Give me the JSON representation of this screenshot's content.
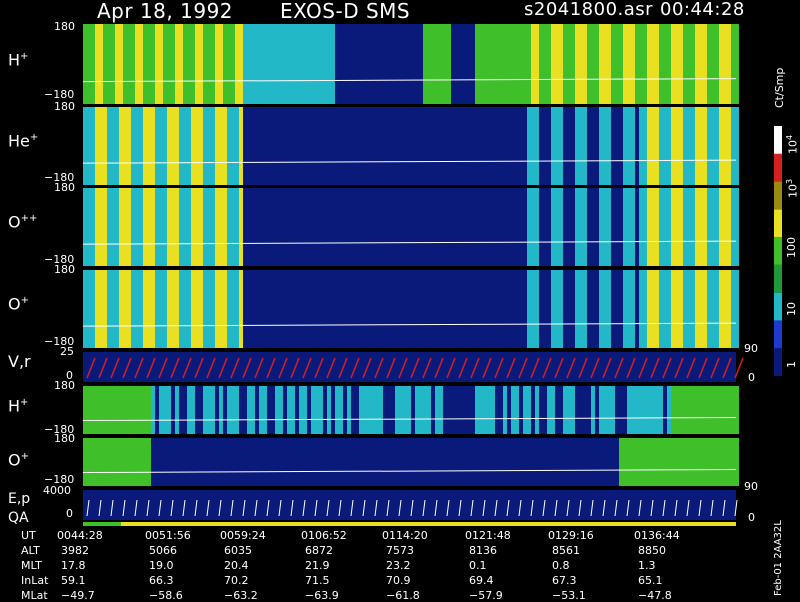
{
  "header": {
    "date": "Apr 18, 1992",
    "instrument": "EXOS-D SMS",
    "file": "s2041800.asr",
    "time": "00:44:28"
  },
  "panels": [
    {
      "label": "H",
      "sup": "+",
      "tick_top": "180",
      "tick_bottom": "−180"
    },
    {
      "label": "He",
      "sup": "+",
      "tick_top": "180",
      "tick_bottom": "−180"
    },
    {
      "label": "O",
      "sup": "++",
      "tick_top": "180",
      "tick_bottom": "−180"
    },
    {
      "label": "O",
      "sup": "+",
      "tick_top": "180",
      "tick_bottom": "−180"
    },
    {
      "label": "V,r",
      "sup": "",
      "tick_top": "25",
      "tick_bottom": "0",
      "tick_right_top": "90",
      "tick_right_bottom": "0"
    },
    {
      "label": "H",
      "sup": "+",
      "tick_top": "180",
      "tick_bottom": "−180"
    },
    {
      "label": "O",
      "sup": "+",
      "tick_top": "180",
      "tick_bottom": "−180",
      "tick_right_bottom": "90"
    },
    {
      "label": "E,p",
      "sup": "",
      "label2": "QA",
      "tick_top": "4000",
      "tick_bottom": "0",
      "tick_right_bottom": "0"
    }
  ],
  "colorbar": {
    "unit": "Ct/Smp",
    "ticks": [
      {
        "base": "10",
        "exp": "4"
      },
      {
        "base": "10",
        "exp": "3"
      },
      {
        "base": "100",
        "exp": ""
      },
      {
        "base": "10",
        "exp": ""
      },
      {
        "base": "1",
        "exp": ""
      }
    ]
  },
  "footer": {
    "side_label": "Feb-01 2AA32L",
    "rows": [
      {
        "name": "UT",
        "values": [
          "0044:28",
          "0051:56",
          "0059:24",
          "0106:52",
          "0114:20",
          "0121:48",
          "0129:16",
          "0136:44"
        ]
      },
      {
        "name": "ALT",
        "values": [
          "3982",
          "5066",
          "6035",
          "6872",
          "7573",
          "8136",
          "8561",
          "8850"
        ]
      },
      {
        "name": "MLT",
        "values": [
          "17.8",
          "19.0",
          "20.4",
          "21.9",
          "23.2",
          "0.1",
          "0.8",
          "1.3"
        ]
      },
      {
        "name": "InLat",
        "values": [
          "59.1",
          "66.3",
          "70.2",
          "71.5",
          "70.9",
          "69.4",
          "67.3",
          "65.1"
        ]
      },
      {
        "name": "MLat",
        "values": [
          "−49.7",
          "−58.6",
          "−63.2",
          "−63.9",
          "−61.8",
          "−57.9",
          "−53.1",
          "−47.8"
        ]
      }
    ]
  },
  "chart_data": {
    "type": "heatmap",
    "title": "Apr 18, 1992   EXOS-D SMS",
    "x_axis": "UT",
    "x_ticks": [
      "0044:28",
      "0051:56",
      "0059:24",
      "0106:52",
      "0114:20",
      "0121:48",
      "0129:16",
      "0136:44"
    ],
    "panels": [
      {
        "species": "H+",
        "y_range": [
          -180,
          180
        ],
        "high_count_intervals": [
          "0044:28-0059:24",
          "0121:48-0139:00"
        ]
      },
      {
        "species": "He+",
        "y_range": [
          -180,
          180
        ],
        "high_count_intervals": [
          "0044:28-0056:00",
          "0118:00-0139:00"
        ]
      },
      {
        "species": "O++",
        "y_range": [
          -180,
          180
        ],
        "high_count_intervals": [
          "0044:28-0056:00",
          "0118:00-0139:00"
        ]
      },
      {
        "species": "O+",
        "y_range": [
          -180,
          180
        ],
        "high_count_intervals": [
          "0044:28-0056:00",
          "0118:00-0139:00"
        ]
      },
      {
        "species": "V,r",
        "y_range": [
          0,
          25
        ],
        "right_range": [
          0,
          90
        ]
      },
      {
        "species": "H+",
        "y_range": [
          -180,
          180
        ]
      },
      {
        "species": "O+",
        "y_range": [
          -180,
          180
        ]
      },
      {
        "species": "E,p",
        "y_range": [
          0,
          4000
        ]
      }
    ],
    "colorbar": {
      "unit": "Ct/Smp",
      "scale": "log",
      "range": [
        1,
        10000
      ]
    },
    "colors": {
      "low": "#0a1a7a",
      "mid": "#22b8c8",
      "green": "#3fbf2a",
      "yellow": "#e8e020",
      "red": "#d42020"
    }
  }
}
